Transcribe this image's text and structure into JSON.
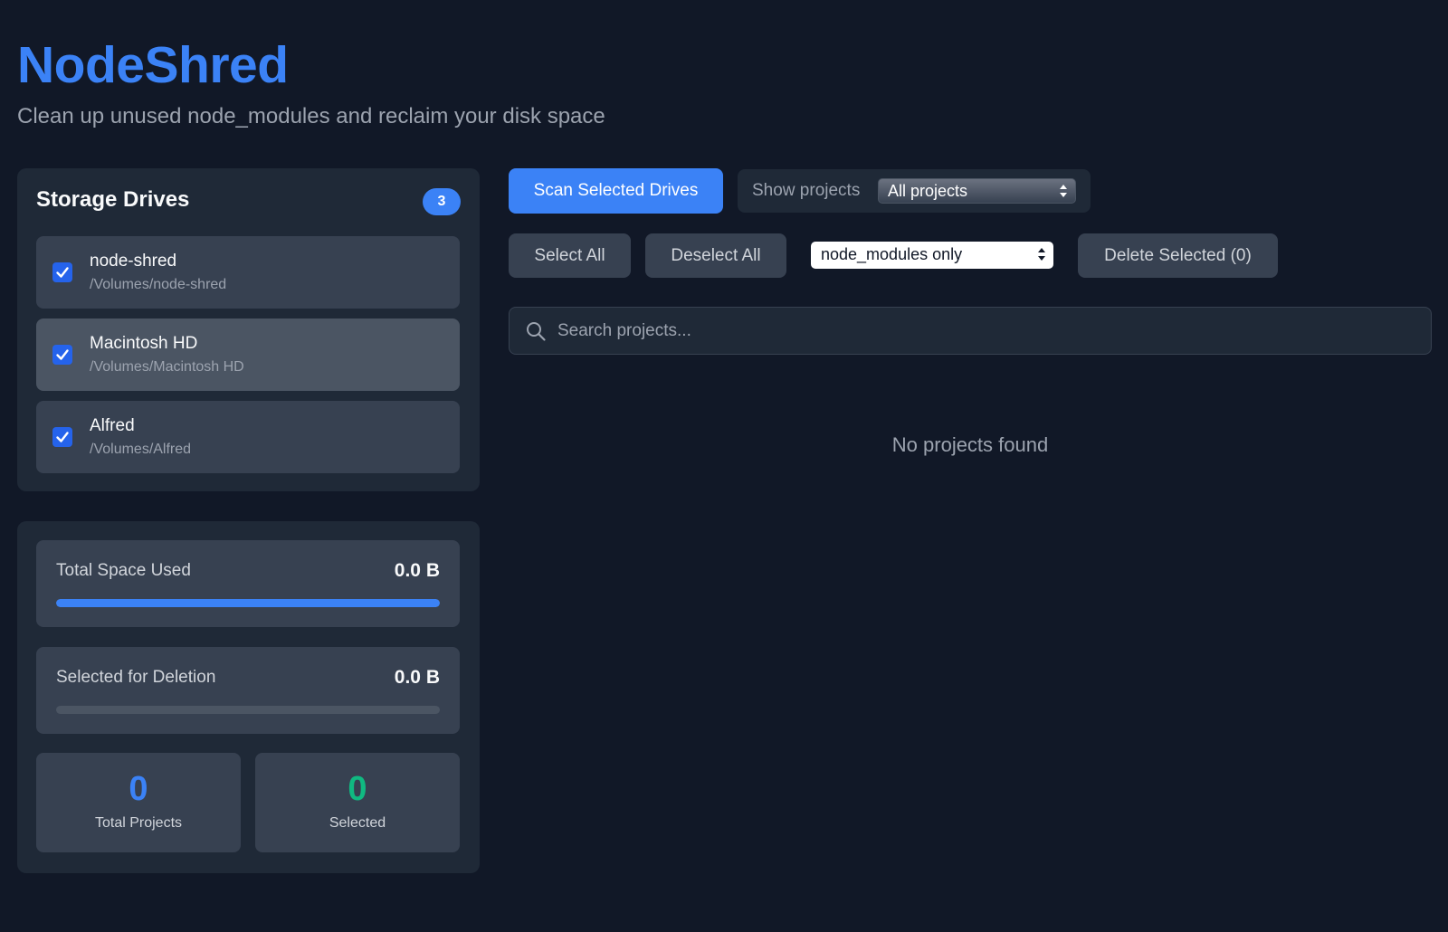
{
  "header": {
    "title": "NodeShred",
    "subtitle": "Clean up unused node_modules and reclaim your disk space"
  },
  "drives": {
    "title": "Storage Drives",
    "count": "3",
    "items": [
      {
        "name": "node-shred",
        "path": "/Volumes/node-shred",
        "checked": true
      },
      {
        "name": "Macintosh HD",
        "path": "/Volumes/Macintosh HD",
        "checked": true
      },
      {
        "name": "Alfred",
        "path": "/Volumes/Alfred",
        "checked": true
      }
    ]
  },
  "stats": {
    "total_space": {
      "label": "Total Space Used",
      "value": "0.0 B",
      "progress": 1.0
    },
    "selected_deletion": {
      "label": "Selected for Deletion",
      "value": "0.0 B",
      "progress": 0.0
    },
    "total_projects": {
      "value": "0",
      "label": "Total Projects"
    },
    "selected": {
      "value": "0",
      "label": "Selected"
    }
  },
  "toolbar": {
    "scan_label": "Scan Selected Drives",
    "show_label": "Show projects",
    "show_value": "All projects",
    "select_all_label": "Select All",
    "deselect_all_label": "Deselect All",
    "filter_value": "node_modules only",
    "delete_label": "Delete Selected (0)"
  },
  "search": {
    "placeholder": "Search projects..."
  },
  "empty_state": "No projects found",
  "colors": {
    "background": "#111827",
    "panel": "#1f2937",
    "card": "#374151",
    "accent": "#3b82f6",
    "success": "#10b981"
  },
  "icons": {
    "checkbox": "check-icon",
    "search": "search-icon",
    "select": "select-arrows-icon"
  }
}
